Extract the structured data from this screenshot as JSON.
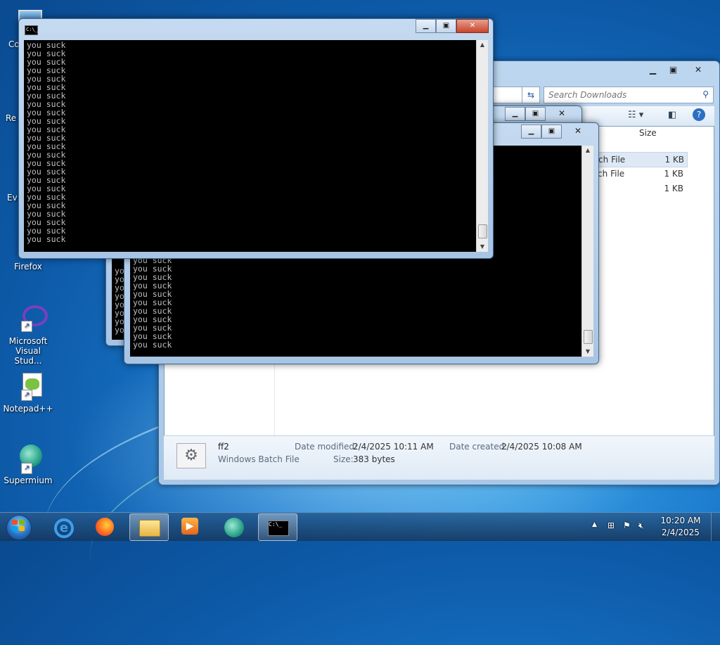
{
  "desktop": {
    "icons": [
      {
        "name": "Co",
        "icon": "computer-icon"
      },
      {
        "name": "Re",
        "icon": "recycle-bin-icon"
      },
      {
        "name": "Ev",
        "icon": "shortcut-icon"
      },
      {
        "name": "Firefox",
        "icon": "firefox-icon"
      },
      {
        "name": "Microsoft Visual Stud...",
        "icon": "visual-studio-icon"
      },
      {
        "name": "Notepad++",
        "icon": "notepadpp-icon"
      },
      {
        "name": "Supermium",
        "icon": "supermium-icon"
      }
    ]
  },
  "explorer": {
    "search_placeholder": "Search Downloads",
    "column_size": "Size",
    "files": [
      {
        "type": "atch File",
        "size": "1 KB"
      },
      {
        "type": "atch File",
        "size": "1 KB"
      },
      {
        "type": "",
        "size": "1 KB"
      }
    ],
    "details": {
      "filename": "ff2",
      "filetype": "Windows Batch File",
      "modified_label": "Date modified:",
      "modified_value": "2/4/2025 10:11 AM",
      "size_label": "Size:",
      "size_value": "383 bytes",
      "created_label": "Date created:",
      "created_value": "2/4/2025 10:08 AM"
    }
  },
  "consoles": {
    "line_text": "you suck",
    "front_lines": 24,
    "middle_lines": 11,
    "back_prefix": "yo",
    "back_lines": 8
  },
  "taskbar": {
    "time": "10:20 AM",
    "date": "2/4/2025",
    "apps": [
      "internet-explorer-icon",
      "firefox-icon",
      "file-explorer-icon",
      "media-player-icon",
      "supermium-icon",
      "command-prompt-icon"
    ]
  },
  "colors": {
    "console_text": "#c0c0c0",
    "console_bg": "#000000",
    "wallpaper": "#1a78cc"
  }
}
